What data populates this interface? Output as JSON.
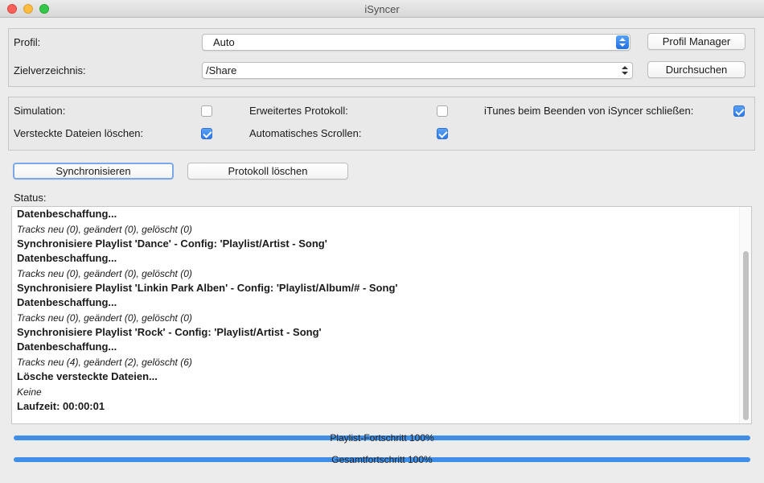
{
  "window": {
    "title": "iSyncer"
  },
  "profile": {
    "label": "Profil:",
    "value": "Auto",
    "manager_button": "Profil Manager"
  },
  "target": {
    "label": "Zielverzeichnis:",
    "value": "/Share",
    "browse_button": "Durchsuchen"
  },
  "options": {
    "simulation": {
      "label": "Simulation:",
      "checked": false
    },
    "extended_log": {
      "label": "Erweitertes Protokoll:",
      "checked": false
    },
    "close_itunes": {
      "label": "iTunes beim Beenden von iSyncer schließen:",
      "checked": true
    },
    "delete_hidden": {
      "label": "Versteckte Dateien löschen:",
      "checked": true
    },
    "auto_scroll": {
      "label": "Automatisches Scrollen:",
      "checked": true
    }
  },
  "actions": {
    "sync_button": "Synchronisieren",
    "clear_log_button": "Protokoll löschen"
  },
  "status": {
    "label": "Status:",
    "lines": [
      {
        "text": "Datenbeschaffung...",
        "style": "bold"
      },
      {
        "text": "Tracks neu (0), geändert (0), gelöscht (0)",
        "style": "italic"
      },
      {
        "text": "Synchronisiere Playlist 'Dance' - Config: 'Playlist/Artist - Song'",
        "style": "bold"
      },
      {
        "text": "Datenbeschaffung...",
        "style": "bold"
      },
      {
        "text": "Tracks neu (0), geändert (0), gelöscht (0)",
        "style": "italic"
      },
      {
        "text": "Synchronisiere Playlist 'Linkin Park Alben' - Config: 'Playlist/Album/# - Song'",
        "style": "bold"
      },
      {
        "text": "Datenbeschaffung...",
        "style": "bold"
      },
      {
        "text": "Tracks neu (0), geändert (0), gelöscht (0)",
        "style": "italic"
      },
      {
        "text": "Synchronisiere Playlist 'Rock' - Config: 'Playlist/Artist - Song'",
        "style": "bold"
      },
      {
        "text": "Datenbeschaffung...",
        "style": "bold"
      },
      {
        "text": "Tracks neu (4), geändert (2), gelöscht (6)",
        "style": "italic"
      },
      {
        "text": "Lösche versteckte Dateien...",
        "style": "bold"
      },
      {
        "text": "Keine",
        "style": "italic"
      },
      {
        "text": "Laufzeit: 00:00:01",
        "style": "bold"
      }
    ]
  },
  "progress": {
    "playlist": {
      "label": "Playlist-Fortschritt 100%",
      "percent": 100
    },
    "total": {
      "label": "Gesamtfortschritt 100%",
      "percent": 100
    }
  },
  "colors": {
    "accent": "#3f8ee8"
  }
}
